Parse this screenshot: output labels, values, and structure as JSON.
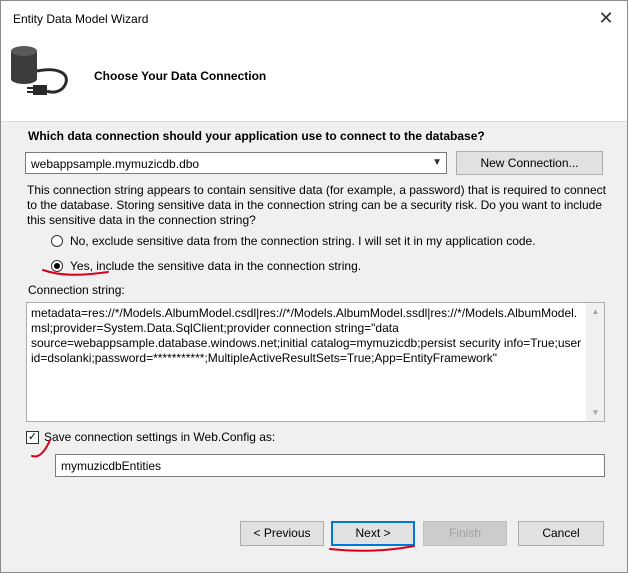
{
  "window": {
    "title": "Entity Data Model Wizard",
    "close_glyph": "✕"
  },
  "header": {
    "title": "Choose Your Data Connection",
    "icon": "database-plug-icon"
  },
  "connection": {
    "question": "Which data connection should your application use to connect to the database?",
    "selected": "webappsample.mymuzicdb.dbo",
    "new_connection_label": "New Connection..."
  },
  "sensitive": {
    "description": "This connection string appears to contain sensitive data (for example, a password) that is required to connect to the database. Storing sensitive data in the connection string can be a security risk. Do you want to include this sensitive data in the connection string?",
    "option_no": "No, exclude sensitive data from the connection string. I will set it in my application code.",
    "option_yes": "Yes, include the sensitive data in the connection string.",
    "selected": "yes"
  },
  "connection_string": {
    "label": "Connection string:",
    "value": "metadata=res://*/Models.AlbumModel.csdl|res://*/Models.AlbumModel.ssdl|res://*/Models.AlbumModel.msl;provider=System.Data.SqlClient;provider connection string=\"data source=webappsample.database.windows.net;initial catalog=mymuzicdb;persist security info=True;user id=dsolanki;password=***********;MultipleActiveResultSets=True;App=EntityFramework\""
  },
  "save_settings": {
    "label": "Save connection settings in Web.Config as:",
    "checked": true,
    "name": "mymuzicdbEntities"
  },
  "buttons": {
    "previous": "< Previous",
    "next": "Next >",
    "finish": "Finish",
    "cancel": "Cancel"
  },
  "colors": {
    "annotation": "#d6001c",
    "focus": "#0078d7"
  }
}
